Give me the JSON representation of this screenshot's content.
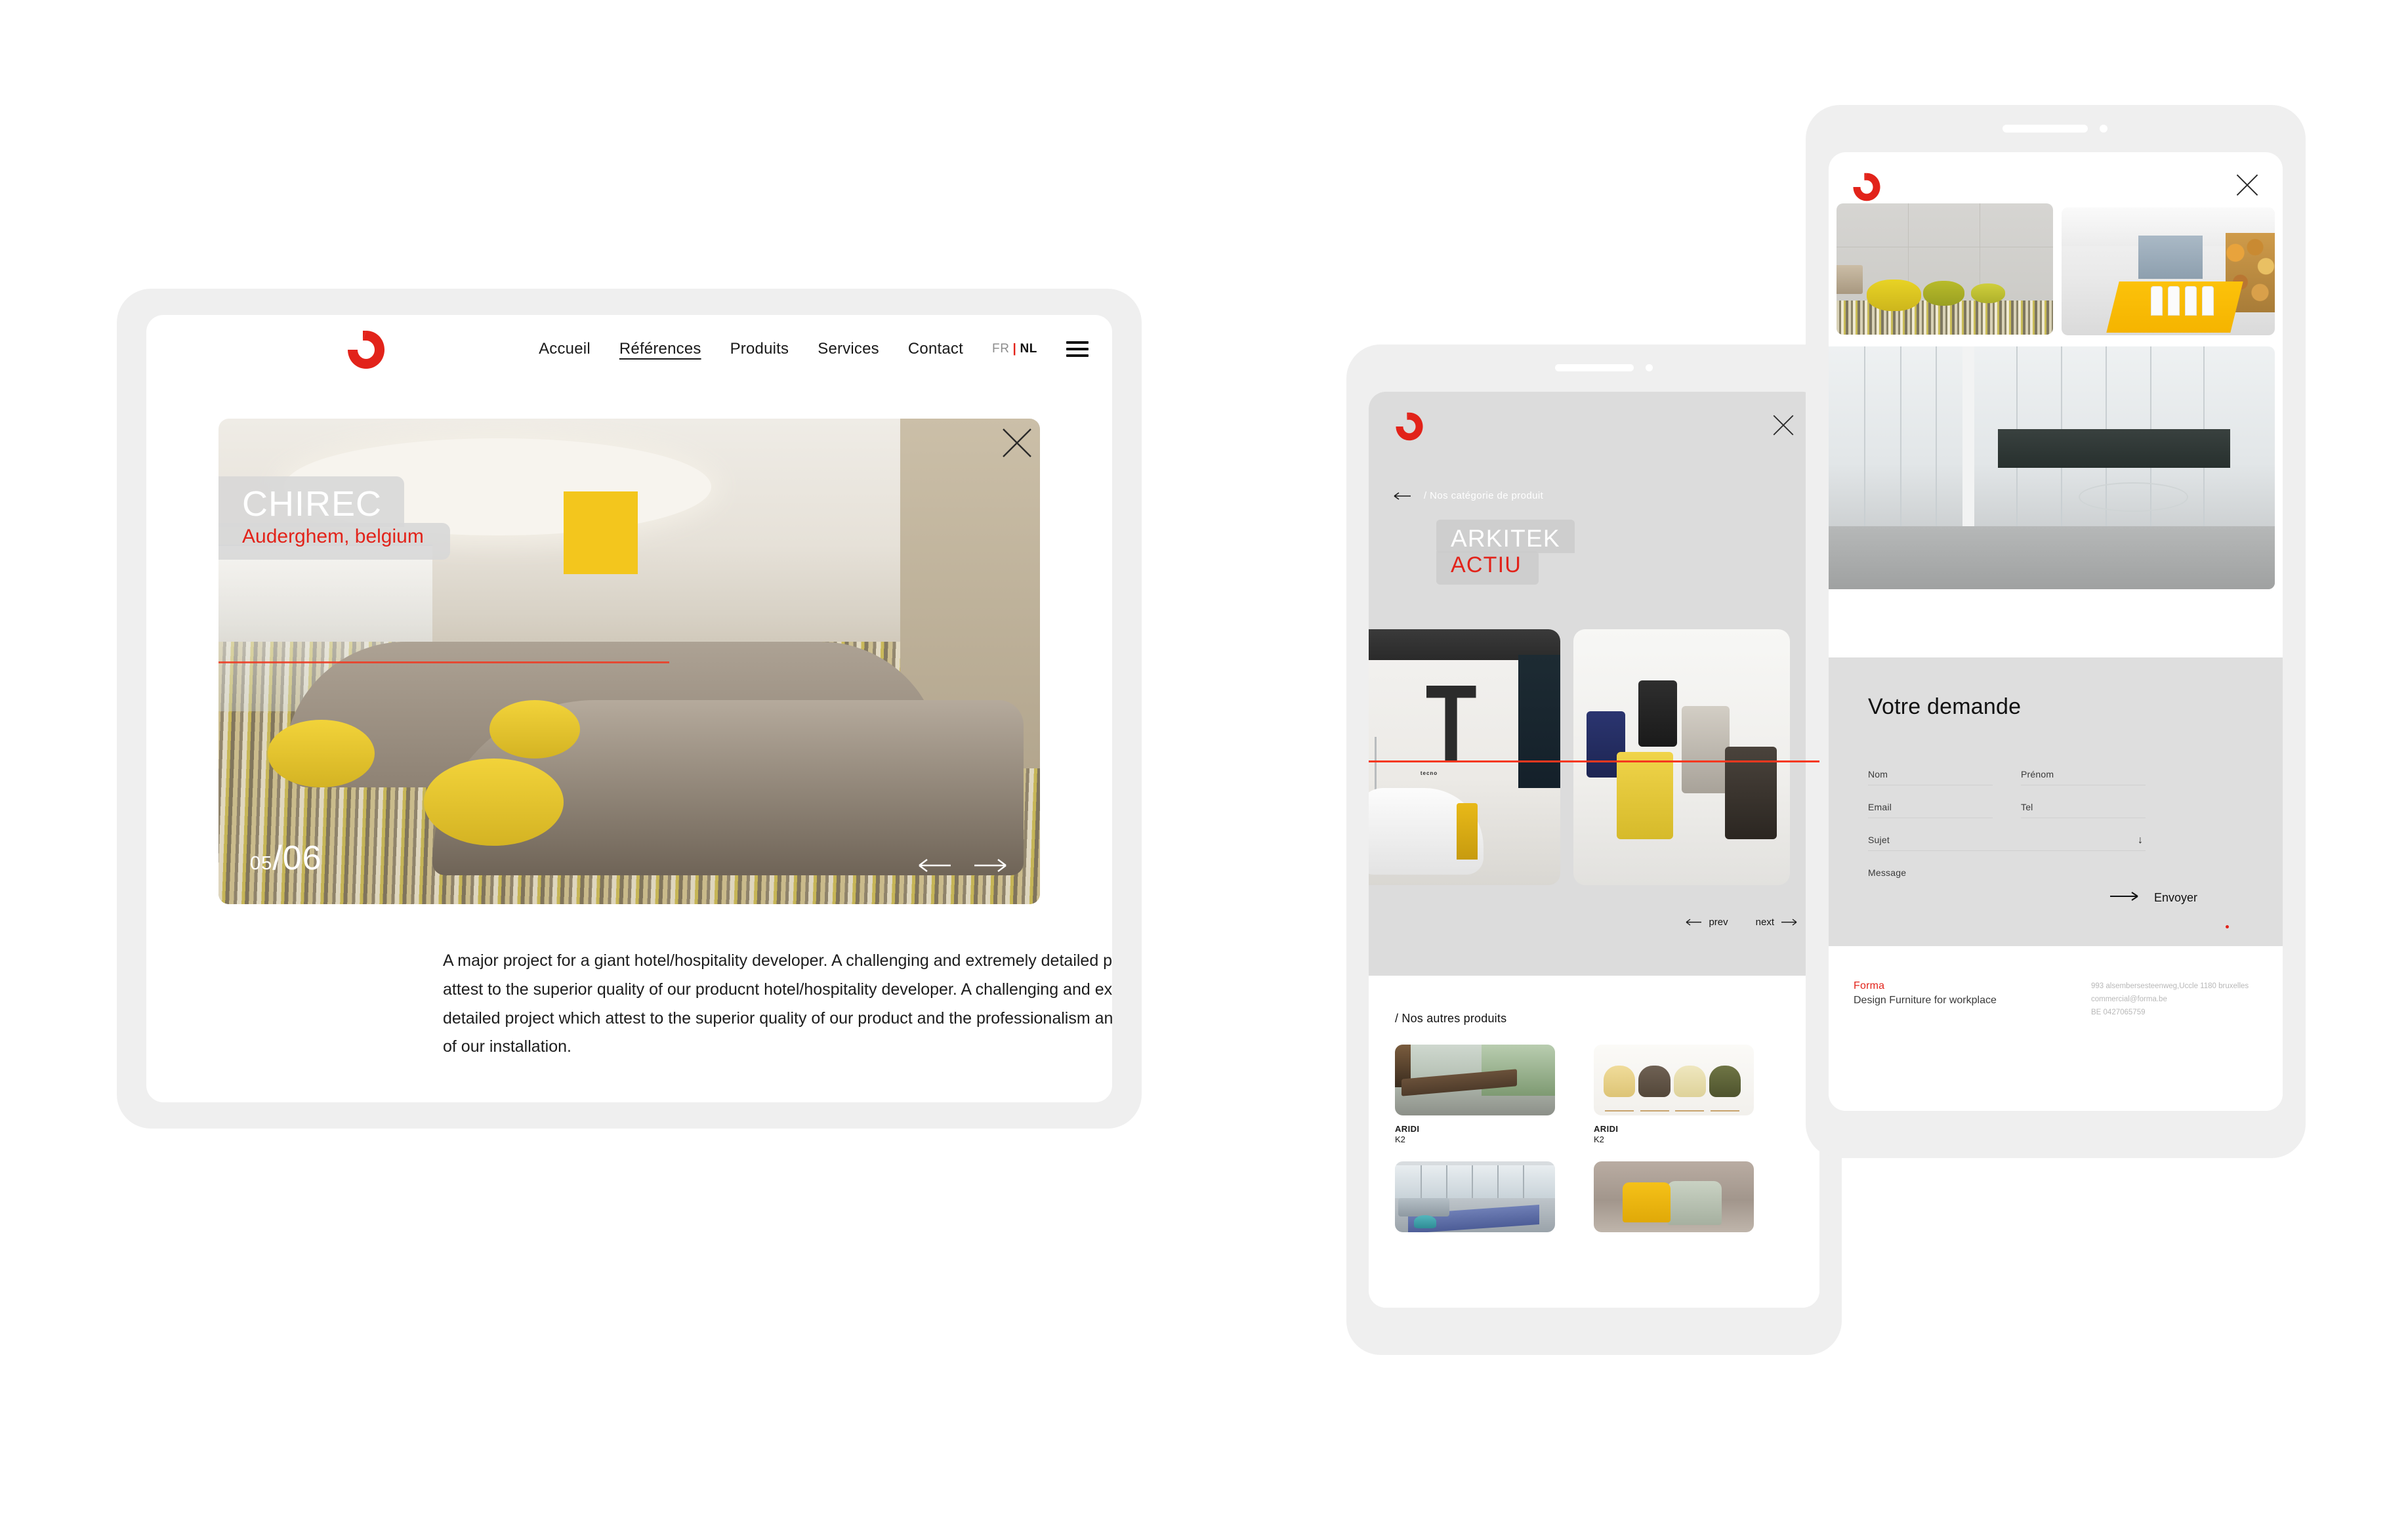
{
  "brand": {
    "logo_name": "forma-logo-icon",
    "accent_color": "#e2231a",
    "frame_color": "#efefef",
    "panel_color": "#dcdcdc"
  },
  "tablet_left": {
    "nav": {
      "items": [
        {
          "label": "Accueil",
          "active": false
        },
        {
          "label": "Références",
          "active": true
        },
        {
          "label": "Produits",
          "active": false
        },
        {
          "label": "Services",
          "active": false
        },
        {
          "label": "Contact",
          "active": false
        }
      ],
      "lang": {
        "fr": "FR",
        "separator": "|",
        "nl": "NL"
      },
      "menu_icon": "hamburger-menu-icon"
    },
    "hero": {
      "project_title": "CHIREC",
      "project_location": "Auderghem, belgium",
      "slide_current": "05",
      "slide_separator": "/",
      "slide_total": "06",
      "prev_icon": "arrow-left-icon",
      "next_icon": "arrow-right-icon",
      "close_icon": "close-icon"
    },
    "description": "A major project for a giant hotel/hospitality developer. A challenging and extremely detailed project which attest to the superior quality of our producnt hotel/hospitality developer. A challenging and extremely detailed project which attest to the superior quality of our product and the professionalism and expertise of our installation."
  },
  "tablet_mid": {
    "close_icon": "close-icon",
    "breadcrumb": "/ Nos catégorie de produit",
    "back_icon": "arrow-left-icon",
    "category_title": "ARKITEK",
    "category_brand": "ACTIU",
    "pager": {
      "prev_label": "prev",
      "next_label": "next",
      "prev_icon": "arrow-left-icon",
      "next_icon": "arrow-right-icon"
    },
    "others_title": "/ Nos autres produits",
    "products": [
      {
        "name": "ARIDI",
        "code": "K2"
      },
      {
        "name": "ARIDI",
        "code": "K2"
      },
      {
        "name": "",
        "code": ""
      },
      {
        "name": "",
        "code": ""
      }
    ]
  },
  "tablet_right": {
    "close_icon": "close-icon",
    "form": {
      "title": "Votre demande",
      "fields": [
        {
          "label": "Nom",
          "type": "text"
        },
        {
          "label": "Prénom",
          "type": "text"
        },
        {
          "label": "Email",
          "type": "text"
        },
        {
          "label": "Tel",
          "type": "text"
        },
        {
          "label": "Sujet",
          "type": "select",
          "caret": "↓"
        },
        {
          "label": "Message",
          "type": "textarea"
        }
      ],
      "submit_label": "Envoyer",
      "submit_icon": "arrow-right-icon"
    },
    "footer": {
      "brand_name": "Forma",
      "tagline": "Design Furniture for workplace",
      "address": "993 alsembersesteenweg,Uccle 1180 bruxelles",
      "email": "commercial@forma.be",
      "vat": "BE 0427065759"
    }
  }
}
